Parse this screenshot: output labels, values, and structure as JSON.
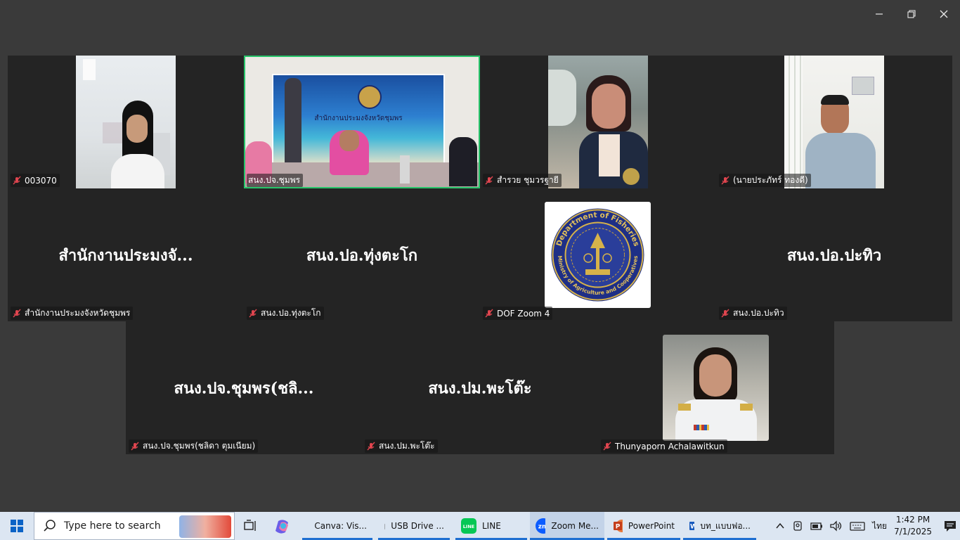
{
  "window": {
    "minimize_icon": "minimize-icon",
    "restore_icon": "restore-icon",
    "close_icon": "close-icon"
  },
  "gallery": {
    "tiles": [
      {
        "id": "t1",
        "name": "003070",
        "big_name": "",
        "muted": true,
        "has_video": true,
        "active": false
      },
      {
        "id": "t2",
        "name": "สนง.ปจ.ชุมพร",
        "big_name": "",
        "muted": false,
        "has_video": true,
        "active": true,
        "banner_text": "สำนักงานประมงจังหวัดชุมพร"
      },
      {
        "id": "t3",
        "name": "สำรวย ชุมวรฐายี",
        "big_name": "",
        "muted": true,
        "has_video": true,
        "active": false
      },
      {
        "id": "t4",
        "name": "(นายประภัทร์ ทองดี)",
        "big_name": "",
        "muted": true,
        "has_video": true,
        "active": false
      },
      {
        "id": "t5",
        "name": "สำนักงานประมงจังหวัดชุมพร",
        "big_name": "สำนักงานประมงจั...",
        "muted": true,
        "has_video": false,
        "active": false
      },
      {
        "id": "t6",
        "name": "สนง.ปอ.ทุ่งตะโก",
        "big_name": "สนง.ปอ.ทุ่งตะโก",
        "muted": true,
        "has_video": false,
        "active": false
      },
      {
        "id": "t7",
        "name": "DOF Zoom 4",
        "big_name": "",
        "muted": true,
        "has_video": false,
        "active": false,
        "logo_text_top": "Department of Fisheries",
        "logo_text_bottom": "Ministry of Agriculture and Cooperatives"
      },
      {
        "id": "t8",
        "name": "สนง.ปอ.ปะทิว",
        "big_name": "สนง.ปอ.ปะทิว",
        "muted": true,
        "has_video": false,
        "active": false
      },
      {
        "id": "t9",
        "name": "สนง.ปจ.ชุมพร(ชลิดา ตุมเนียม)",
        "big_name": "สนง.ปจ.ชุมพร(ชลิ...",
        "muted": true,
        "has_video": false,
        "active": false
      },
      {
        "id": "t10",
        "name": "สนง.ปม.พะโต๊ะ",
        "big_name": "สนง.ปม.พะโต๊ะ",
        "muted": true,
        "has_video": false,
        "active": false
      },
      {
        "id": "t11",
        "name": "Thunyaporn Achalawitkun",
        "big_name": "",
        "muted": true,
        "has_video": true,
        "active": false
      }
    ]
  },
  "taskbar": {
    "search_placeholder": "Type here to search",
    "apps": [
      {
        "label": "Canva: Vis...",
        "icon": "edge-icon",
        "open": true
      },
      {
        "label": "USB Drive ...",
        "icon": "usb-drive-icon",
        "open": true
      },
      {
        "label": "LINE",
        "icon": "line-icon",
        "open": true
      },
      {
        "label": "Zoom Me...",
        "icon": "zoom-icon",
        "open": true,
        "active": true
      },
      {
        "label": "PowerPoint",
        "icon": "powerpoint-icon",
        "open": true
      },
      {
        "label": "บท_แบบฟอ...",
        "icon": "word-icon",
        "open": true
      }
    ],
    "tray": {
      "language": "ไทย",
      "time": "1:42 PM",
      "date": "7/1/2025"
    }
  },
  "colors": {
    "background": "#3a3a3a",
    "tile": "#242424",
    "active_speaker": "#27c46a",
    "muted_mic": "#e0454f",
    "taskbar": "#dce6f2",
    "taskbar_accent": "#1f6fd1"
  }
}
